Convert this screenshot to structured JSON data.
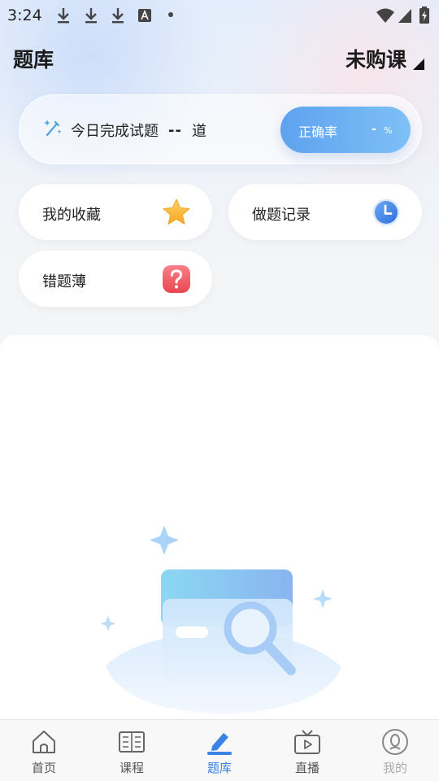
{
  "status_bar": {
    "time": "3:24",
    "icons": [
      "download-icon",
      "download-icon",
      "download-icon",
      "font-a-icon",
      "dot-icon",
      "wifi-icon",
      "signal-icon",
      "battery-icon"
    ]
  },
  "header": {
    "title": "题库",
    "course_status": "未购课"
  },
  "progress": {
    "label": "今日完成试题",
    "count": "--",
    "unit": "道",
    "accuracy_label": "正确率",
    "accuracy_value": "-",
    "accuracy_unit": "%"
  },
  "quick_links": {
    "favorites": "我的收藏",
    "records": "做题记录",
    "wrong_book": "错题薄"
  },
  "tabs": [
    {
      "label": "首页",
      "icon": "home-icon"
    },
    {
      "label": "课程",
      "icon": "course-icon"
    },
    {
      "label": "题库",
      "icon": "question-bank-icon",
      "active": true
    },
    {
      "label": "直播",
      "icon": "tv-icon"
    },
    {
      "label": "我的",
      "icon": "profile-icon"
    }
  ],
  "colors": {
    "accent": "#3b82e6",
    "accuracy_pill_start": "#5ea2ef",
    "accuracy_pill_end": "#7ec0f6",
    "star": "#f7b733",
    "wrong_badge": "#ef5b66",
    "clock": "#3b82e6"
  }
}
